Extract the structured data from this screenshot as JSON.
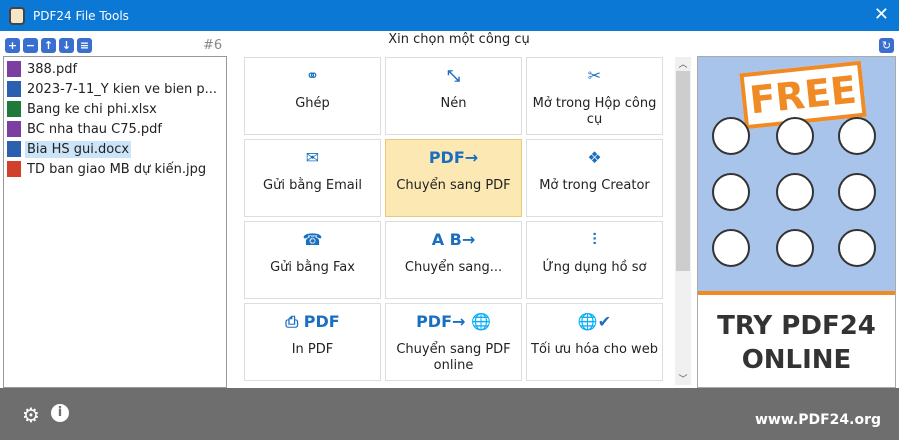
{
  "window": {
    "title": "PDF24 File Tools"
  },
  "files": {
    "count": "#6",
    "items": [
      {
        "name": "388.pdf",
        "type": "pdf"
      },
      {
        "name": "2023-7-11_Y kien ve bien p...",
        "type": "docx"
      },
      {
        "name": "Bang ke chi phi.xlsx",
        "type": "xlsx"
      },
      {
        "name": "BC nha thau C75.pdf",
        "type": "pdf"
      },
      {
        "name": "Bia HS gui.docx",
        "type": "docx",
        "selected": true
      },
      {
        "name": "TD ban giao MB dự kiến.jpg",
        "type": "jpg"
      }
    ]
  },
  "tools": {
    "heading": "Xin chọn một công cụ",
    "items": [
      {
        "label": "Ghép",
        "icon": "⚭"
      },
      {
        "label": "Nén",
        "icon": "⤡"
      },
      {
        "label": "Mở trong Hộp công cụ",
        "icon": "✂"
      },
      {
        "label": "Gửi bằng Email",
        "icon": "✉"
      },
      {
        "label": "Chuyển sang PDF",
        "icon": "PDF→"
      },
      {
        "label": "Mở trong Creator",
        "icon": "❖"
      },
      {
        "label": "Gửi bằng Fax",
        "icon": "☎"
      },
      {
        "label": "Chuyển sang...",
        "icon": "A B→"
      },
      {
        "label": "Ứng dụng hồ sơ",
        "icon": "⫶"
      },
      {
        "label": "In PDF",
        "icon": "⎙ PDF"
      },
      {
        "label": "Chuyển sang PDF online",
        "icon": "PDF→ 🌐"
      },
      {
        "label": "Tối ưu hóa cho web",
        "icon": "🌐✔"
      }
    ]
  },
  "ad": {
    "badge": "FREE",
    "line1": "TRY PDF24",
    "line2": "ONLINE"
  },
  "footer": {
    "url": "www.PDF24.org"
  }
}
